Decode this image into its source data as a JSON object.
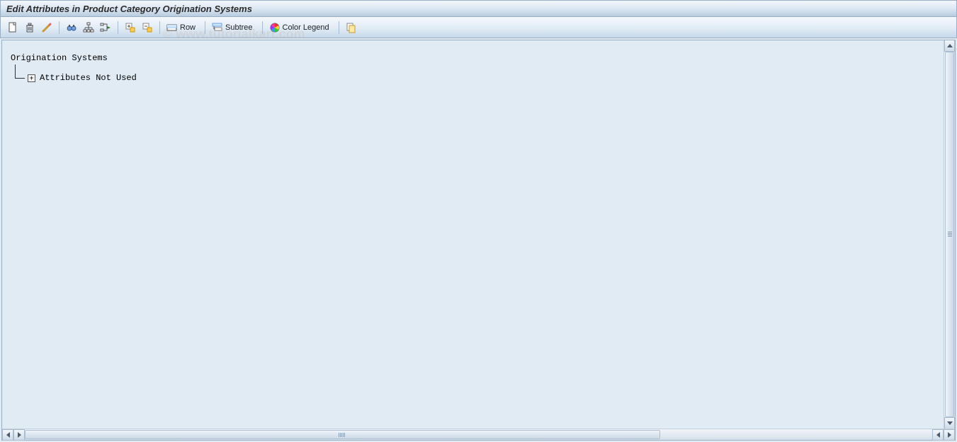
{
  "header": {
    "title": "Edit Attributes in Product Category Origination Systems"
  },
  "toolbar": {
    "btn_create": "Create",
    "btn_delete": "Delete",
    "btn_edit": "Edit",
    "btn_find": "Find",
    "btn_hierarchy": "Hierarchy",
    "btn_where_used": "Where-Used",
    "btn_expand": "Expand",
    "btn_collapse": "Collapse",
    "row_label": "Row",
    "subtree_label": "Subtree",
    "color_legend_label": "Color Legend",
    "btn_copy": "Copy"
  },
  "tree": {
    "root_label": "Origination Systems",
    "child_label": "Attributes Not Used"
  },
  "watermark": "© www.tutorialkart.com"
}
